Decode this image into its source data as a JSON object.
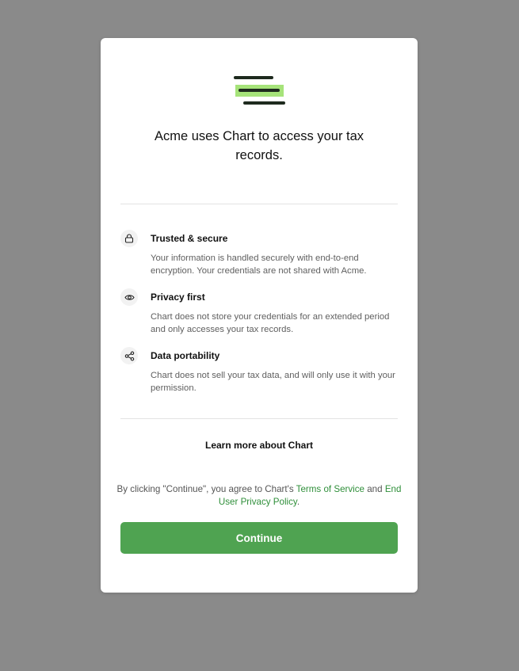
{
  "headline": "Acme uses Chart to access your tax records.",
  "features": [
    {
      "icon": "lock-icon",
      "title": "Trusted & secure",
      "description": "Your information is handled securely with end-to-end encryption. Your credentials are not shared with Acme."
    },
    {
      "icon": "eye-icon",
      "title": "Privacy first",
      "description": "Chart does not store your credentials for an extended period and only accesses your tax records."
    },
    {
      "icon": "share-icon",
      "title": "Data portability",
      "description": "Chart does not sell your tax data, and will only use it with your permission."
    }
  ],
  "learn_more": "Learn more about Chart",
  "consent": {
    "prefix": "By clicking \"Continue\", you agree to Chart's ",
    "terms_link": "Terms of Service",
    "middle": " and ",
    "privacy_link": "End User Privacy Policy",
    "suffix": "."
  },
  "continue_label": "Continue",
  "colors": {
    "accent": "#4fa351",
    "link": "#2f8f3a",
    "logo_highlight": "#a6e37a",
    "overlay": "#8a8a8a"
  }
}
